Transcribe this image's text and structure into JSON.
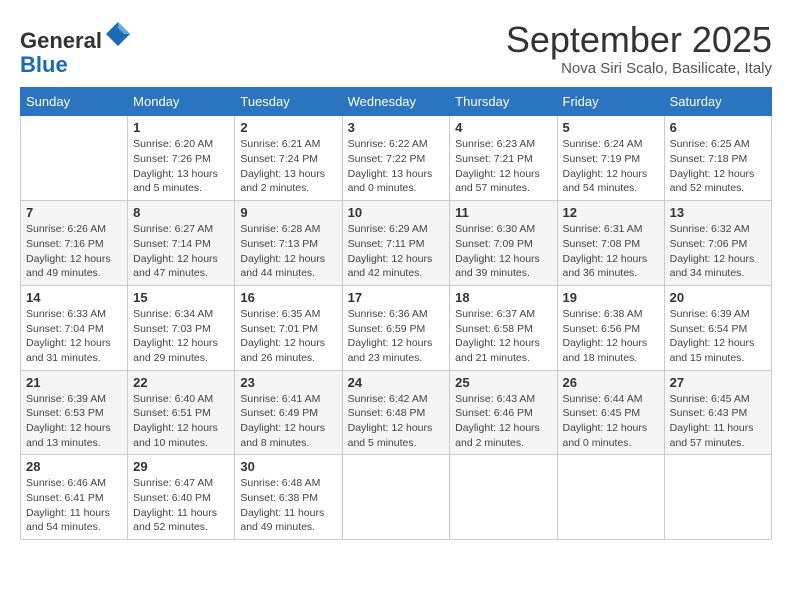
{
  "header": {
    "logo_line1": "General",
    "logo_line2": "Blue",
    "month": "September 2025",
    "location": "Nova Siri Scalo, Basilicate, Italy"
  },
  "days_of_week": [
    "Sunday",
    "Monday",
    "Tuesday",
    "Wednesday",
    "Thursday",
    "Friday",
    "Saturday"
  ],
  "weeks": [
    [
      {
        "day": "",
        "info": ""
      },
      {
        "day": "1",
        "info": "Sunrise: 6:20 AM\nSunset: 7:26 PM\nDaylight: 13 hours\nand 5 minutes."
      },
      {
        "day": "2",
        "info": "Sunrise: 6:21 AM\nSunset: 7:24 PM\nDaylight: 13 hours\nand 2 minutes."
      },
      {
        "day": "3",
        "info": "Sunrise: 6:22 AM\nSunset: 7:22 PM\nDaylight: 13 hours\nand 0 minutes."
      },
      {
        "day": "4",
        "info": "Sunrise: 6:23 AM\nSunset: 7:21 PM\nDaylight: 12 hours\nand 57 minutes."
      },
      {
        "day": "5",
        "info": "Sunrise: 6:24 AM\nSunset: 7:19 PM\nDaylight: 12 hours\nand 54 minutes."
      },
      {
        "day": "6",
        "info": "Sunrise: 6:25 AM\nSunset: 7:18 PM\nDaylight: 12 hours\nand 52 minutes."
      }
    ],
    [
      {
        "day": "7",
        "info": "Sunrise: 6:26 AM\nSunset: 7:16 PM\nDaylight: 12 hours\nand 49 minutes."
      },
      {
        "day": "8",
        "info": "Sunrise: 6:27 AM\nSunset: 7:14 PM\nDaylight: 12 hours\nand 47 minutes."
      },
      {
        "day": "9",
        "info": "Sunrise: 6:28 AM\nSunset: 7:13 PM\nDaylight: 12 hours\nand 44 minutes."
      },
      {
        "day": "10",
        "info": "Sunrise: 6:29 AM\nSunset: 7:11 PM\nDaylight: 12 hours\nand 42 minutes."
      },
      {
        "day": "11",
        "info": "Sunrise: 6:30 AM\nSunset: 7:09 PM\nDaylight: 12 hours\nand 39 minutes."
      },
      {
        "day": "12",
        "info": "Sunrise: 6:31 AM\nSunset: 7:08 PM\nDaylight: 12 hours\nand 36 minutes."
      },
      {
        "day": "13",
        "info": "Sunrise: 6:32 AM\nSunset: 7:06 PM\nDaylight: 12 hours\nand 34 minutes."
      }
    ],
    [
      {
        "day": "14",
        "info": "Sunrise: 6:33 AM\nSunset: 7:04 PM\nDaylight: 12 hours\nand 31 minutes."
      },
      {
        "day": "15",
        "info": "Sunrise: 6:34 AM\nSunset: 7:03 PM\nDaylight: 12 hours\nand 29 minutes."
      },
      {
        "day": "16",
        "info": "Sunrise: 6:35 AM\nSunset: 7:01 PM\nDaylight: 12 hours\nand 26 minutes."
      },
      {
        "day": "17",
        "info": "Sunrise: 6:36 AM\nSunset: 6:59 PM\nDaylight: 12 hours\nand 23 minutes."
      },
      {
        "day": "18",
        "info": "Sunrise: 6:37 AM\nSunset: 6:58 PM\nDaylight: 12 hours\nand 21 minutes."
      },
      {
        "day": "19",
        "info": "Sunrise: 6:38 AM\nSunset: 6:56 PM\nDaylight: 12 hours\nand 18 minutes."
      },
      {
        "day": "20",
        "info": "Sunrise: 6:39 AM\nSunset: 6:54 PM\nDaylight: 12 hours\nand 15 minutes."
      }
    ],
    [
      {
        "day": "21",
        "info": "Sunrise: 6:39 AM\nSunset: 6:53 PM\nDaylight: 12 hours\nand 13 minutes."
      },
      {
        "day": "22",
        "info": "Sunrise: 6:40 AM\nSunset: 6:51 PM\nDaylight: 12 hours\nand 10 minutes."
      },
      {
        "day": "23",
        "info": "Sunrise: 6:41 AM\nSunset: 6:49 PM\nDaylight: 12 hours\nand 8 minutes."
      },
      {
        "day": "24",
        "info": "Sunrise: 6:42 AM\nSunset: 6:48 PM\nDaylight: 12 hours\nand 5 minutes."
      },
      {
        "day": "25",
        "info": "Sunrise: 6:43 AM\nSunset: 6:46 PM\nDaylight: 12 hours\nand 2 minutes."
      },
      {
        "day": "26",
        "info": "Sunrise: 6:44 AM\nSunset: 6:45 PM\nDaylight: 12 hours\nand 0 minutes."
      },
      {
        "day": "27",
        "info": "Sunrise: 6:45 AM\nSunset: 6:43 PM\nDaylight: 11 hours\nand 57 minutes."
      }
    ],
    [
      {
        "day": "28",
        "info": "Sunrise: 6:46 AM\nSunset: 6:41 PM\nDaylight: 11 hours\nand 54 minutes."
      },
      {
        "day": "29",
        "info": "Sunrise: 6:47 AM\nSunset: 6:40 PM\nDaylight: 11 hours\nand 52 minutes."
      },
      {
        "day": "30",
        "info": "Sunrise: 6:48 AM\nSunset: 6:38 PM\nDaylight: 11 hours\nand 49 minutes."
      },
      {
        "day": "",
        "info": ""
      },
      {
        "day": "",
        "info": ""
      },
      {
        "day": "",
        "info": ""
      },
      {
        "day": "",
        "info": ""
      }
    ]
  ]
}
